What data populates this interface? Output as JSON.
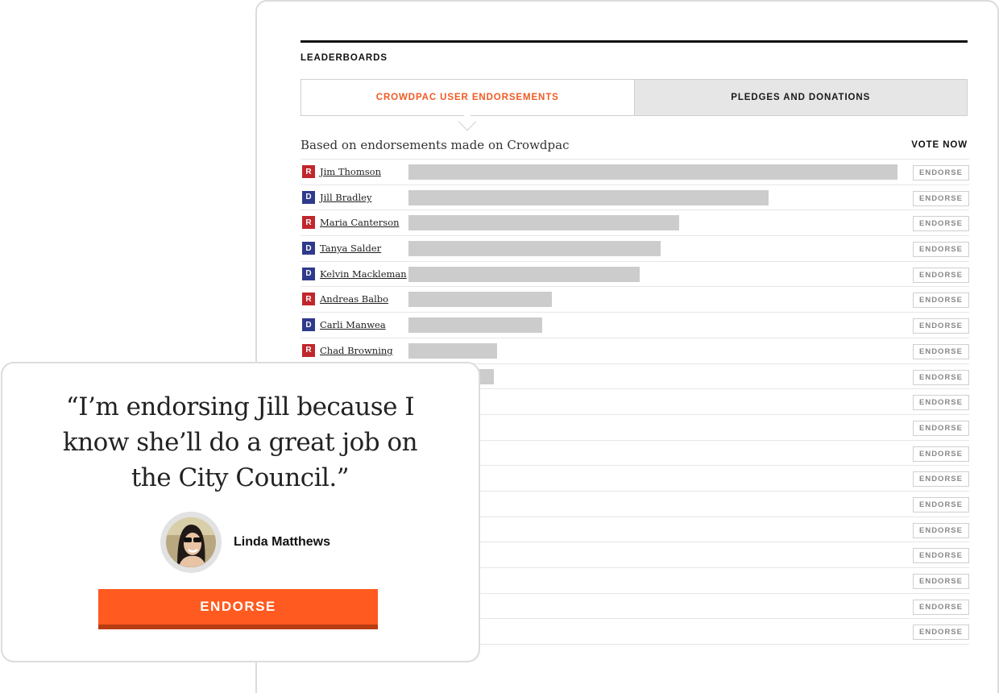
{
  "leaderboard": {
    "section_title": "LEADERBOARDS",
    "tabs": [
      {
        "label": "CROWDPAC USER ENDORSEMENTS",
        "active": true
      },
      {
        "label": "PLEDGES AND DONATIONS",
        "active": false
      }
    ],
    "description": "Based on endorsements made on Crowdpac",
    "vote_now_label": "VOTE NOW",
    "endorse_label": "ENDORSE",
    "party_colors": {
      "R": "#c0272d",
      "D": "#2e3a8c"
    },
    "bar_color": "#cccccc",
    "rows": [
      {
        "party": "R",
        "name": "Jim Thomson",
        "share": 1.0
      },
      {
        "party": "D",
        "name": "Jill Bradley",
        "share": 0.737
      },
      {
        "party": "R",
        "name": "Maria Canterson",
        "share": 0.553
      },
      {
        "party": "D",
        "name": "Tanya Salder",
        "share": 0.515
      },
      {
        "party": "D",
        "name": "Kelvin Mackleman",
        "share": 0.472
      },
      {
        "party": "R",
        "name": "Andreas Balbo",
        "share": 0.294
      },
      {
        "party": "D",
        "name": "Carli Manwea",
        "share": 0.274
      },
      {
        "party": "R",
        "name": "Chad Browning",
        "share": 0.181
      },
      {
        "party": "",
        "name": "",
        "share": 0.175
      },
      {
        "party": "",
        "name": "",
        "share": 0
      },
      {
        "party": "",
        "name": "",
        "share": 0
      },
      {
        "party": "",
        "name": "",
        "share": 0
      },
      {
        "party": "",
        "name": "",
        "share": 0
      },
      {
        "party": "",
        "name": "",
        "share": 0
      },
      {
        "party": "",
        "name": "",
        "share": 0
      },
      {
        "party": "",
        "name": "",
        "share": 0
      },
      {
        "party": "",
        "name": "",
        "share": 0
      },
      {
        "party": "",
        "name": "",
        "share": 0
      },
      {
        "party": "",
        "name": "",
        "share": 0
      }
    ]
  },
  "quote_card": {
    "quote_line_1": "“I’m endorsing Jill because I",
    "quote_line_2": "know she’ll do a great job on",
    "quote_line_3": "the City Council.”",
    "author_name": "Linda Matthews",
    "cta_label": "ENDORSE",
    "cta_color": "#ff5a1f"
  }
}
